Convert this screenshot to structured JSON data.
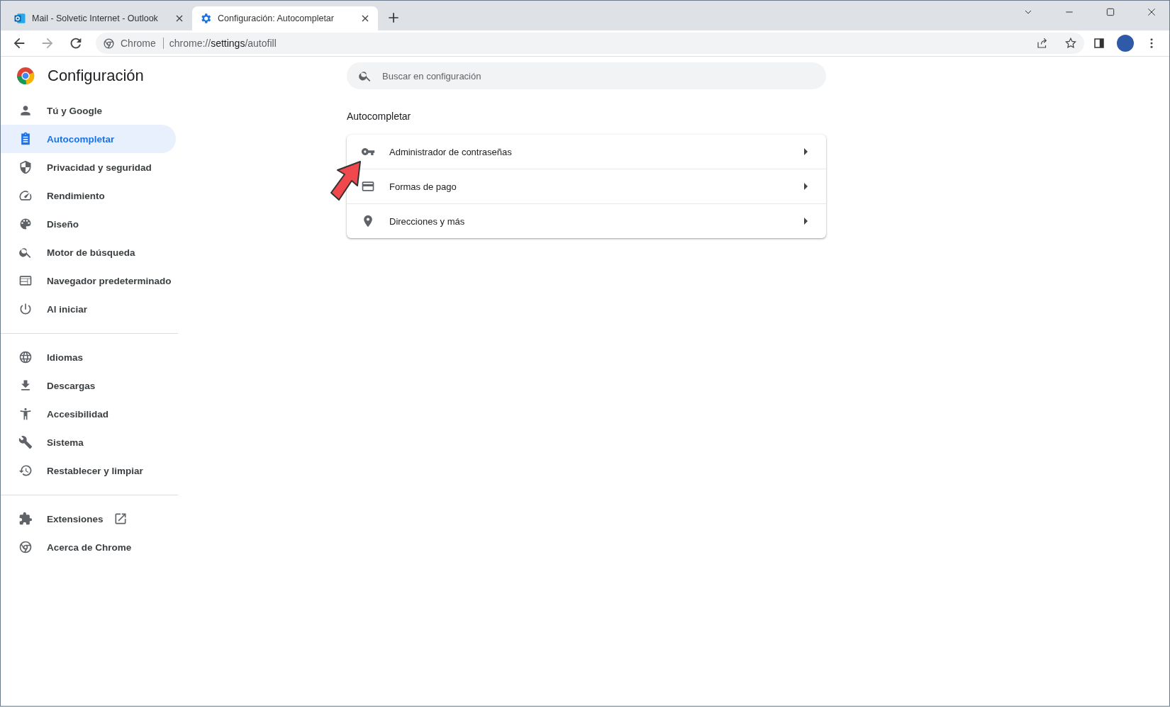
{
  "tabs": [
    {
      "label": "Mail - Solvetic Internet - Outlook",
      "selected": false
    },
    {
      "label": "Configuración: Autocompletar",
      "selected": true
    }
  ],
  "toolbar": {
    "site_label": "Chrome",
    "url_host": "chrome://",
    "url_path": "settings",
    "url_rest": "/autofill"
  },
  "sidebar": {
    "title": "Configuración",
    "groups": [
      [
        {
          "label": "Tú y Google",
          "selected": false
        },
        {
          "label": "Autocompletar",
          "selected": true
        },
        {
          "label": "Privacidad y seguridad",
          "selected": false
        },
        {
          "label": "Rendimiento",
          "selected": false
        },
        {
          "label": "Diseño",
          "selected": false
        },
        {
          "label": "Motor de búsqueda",
          "selected": false
        },
        {
          "label": "Navegador predeterminado",
          "selected": false
        },
        {
          "label": "Al iniciar",
          "selected": false
        }
      ],
      [
        {
          "label": "Idiomas",
          "selected": false
        },
        {
          "label": "Descargas",
          "selected": false
        },
        {
          "label": "Accesibilidad",
          "selected": false
        },
        {
          "label": "Sistema",
          "selected": false
        },
        {
          "label": "Restablecer y limpiar",
          "selected": false
        }
      ],
      [
        {
          "label": "Extensiones",
          "selected": false,
          "external": true
        },
        {
          "label": "Acerca de Chrome",
          "selected": false
        }
      ]
    ]
  },
  "search": {
    "placeholder": "Buscar en configuración"
  },
  "section": {
    "title": "Autocompletar",
    "rows": [
      {
        "label": "Administrador de contraseñas"
      },
      {
        "label": "Formas de pago"
      },
      {
        "label": "Direcciones y más"
      }
    ]
  }
}
